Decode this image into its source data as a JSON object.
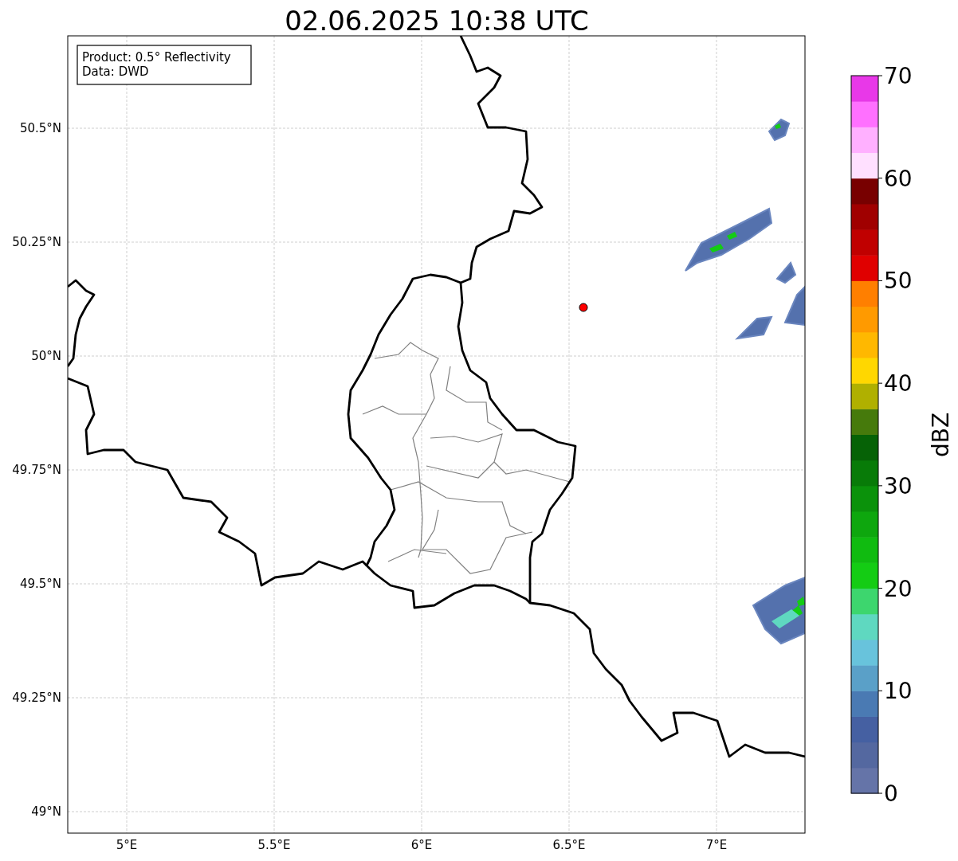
{
  "title": "02.06.2025 10:38 UTC",
  "info_box": {
    "lines": [
      "Product: 0.5° Reflectivity",
      "Data: DWD"
    ]
  },
  "map": {
    "x_ticks": [
      "5°E",
      "5.5°E",
      "6°E",
      "6.5°E",
      "7°E"
    ],
    "y_ticks": [
      "50.5°N",
      "50.25°N",
      "50°N",
      "49.75°N",
      "49.5°N",
      "49.25°N",
      "49°N"
    ]
  },
  "colorbar": {
    "label": "dBZ",
    "ticks": [
      "70",
      "60",
      "50",
      "40",
      "30",
      "20",
      "10",
      "0"
    ],
    "segments": [
      {
        "color": "#6574a8"
      },
      {
        "color": "#5468a0"
      },
      {
        "color": "#4560a2"
      },
      {
        "color": "#4a7ab3"
      },
      {
        "color": "#5aa0c8"
      },
      {
        "color": "#68c3dc"
      },
      {
        "color": "#5fd8c0"
      },
      {
        "color": "#3dd66e"
      },
      {
        "color": "#14cc14"
      },
      {
        "color": "#10bb10"
      },
      {
        "color": "#0ea70e"
      },
      {
        "color": "#0b920b"
      },
      {
        "color": "#087b08"
      },
      {
        "color": "#066206"
      },
      {
        "color": "#467a0c"
      },
      {
        "color": "#b0b000"
      },
      {
        "color": "#ffd700"
      },
      {
        "color": "#ffb800"
      },
      {
        "color": "#ff9a00"
      },
      {
        "color": "#ff7f00"
      },
      {
        "color": "#e00000"
      },
      {
        "color": "#c00000"
      },
      {
        "color": "#a00000"
      },
      {
        "color": "#780000"
      },
      {
        "color": "#ffe0ff"
      },
      {
        "color": "#ffb0ff"
      },
      {
        "color": "#ff70ff"
      },
      {
        "color": "#e838e8"
      }
    ]
  }
}
